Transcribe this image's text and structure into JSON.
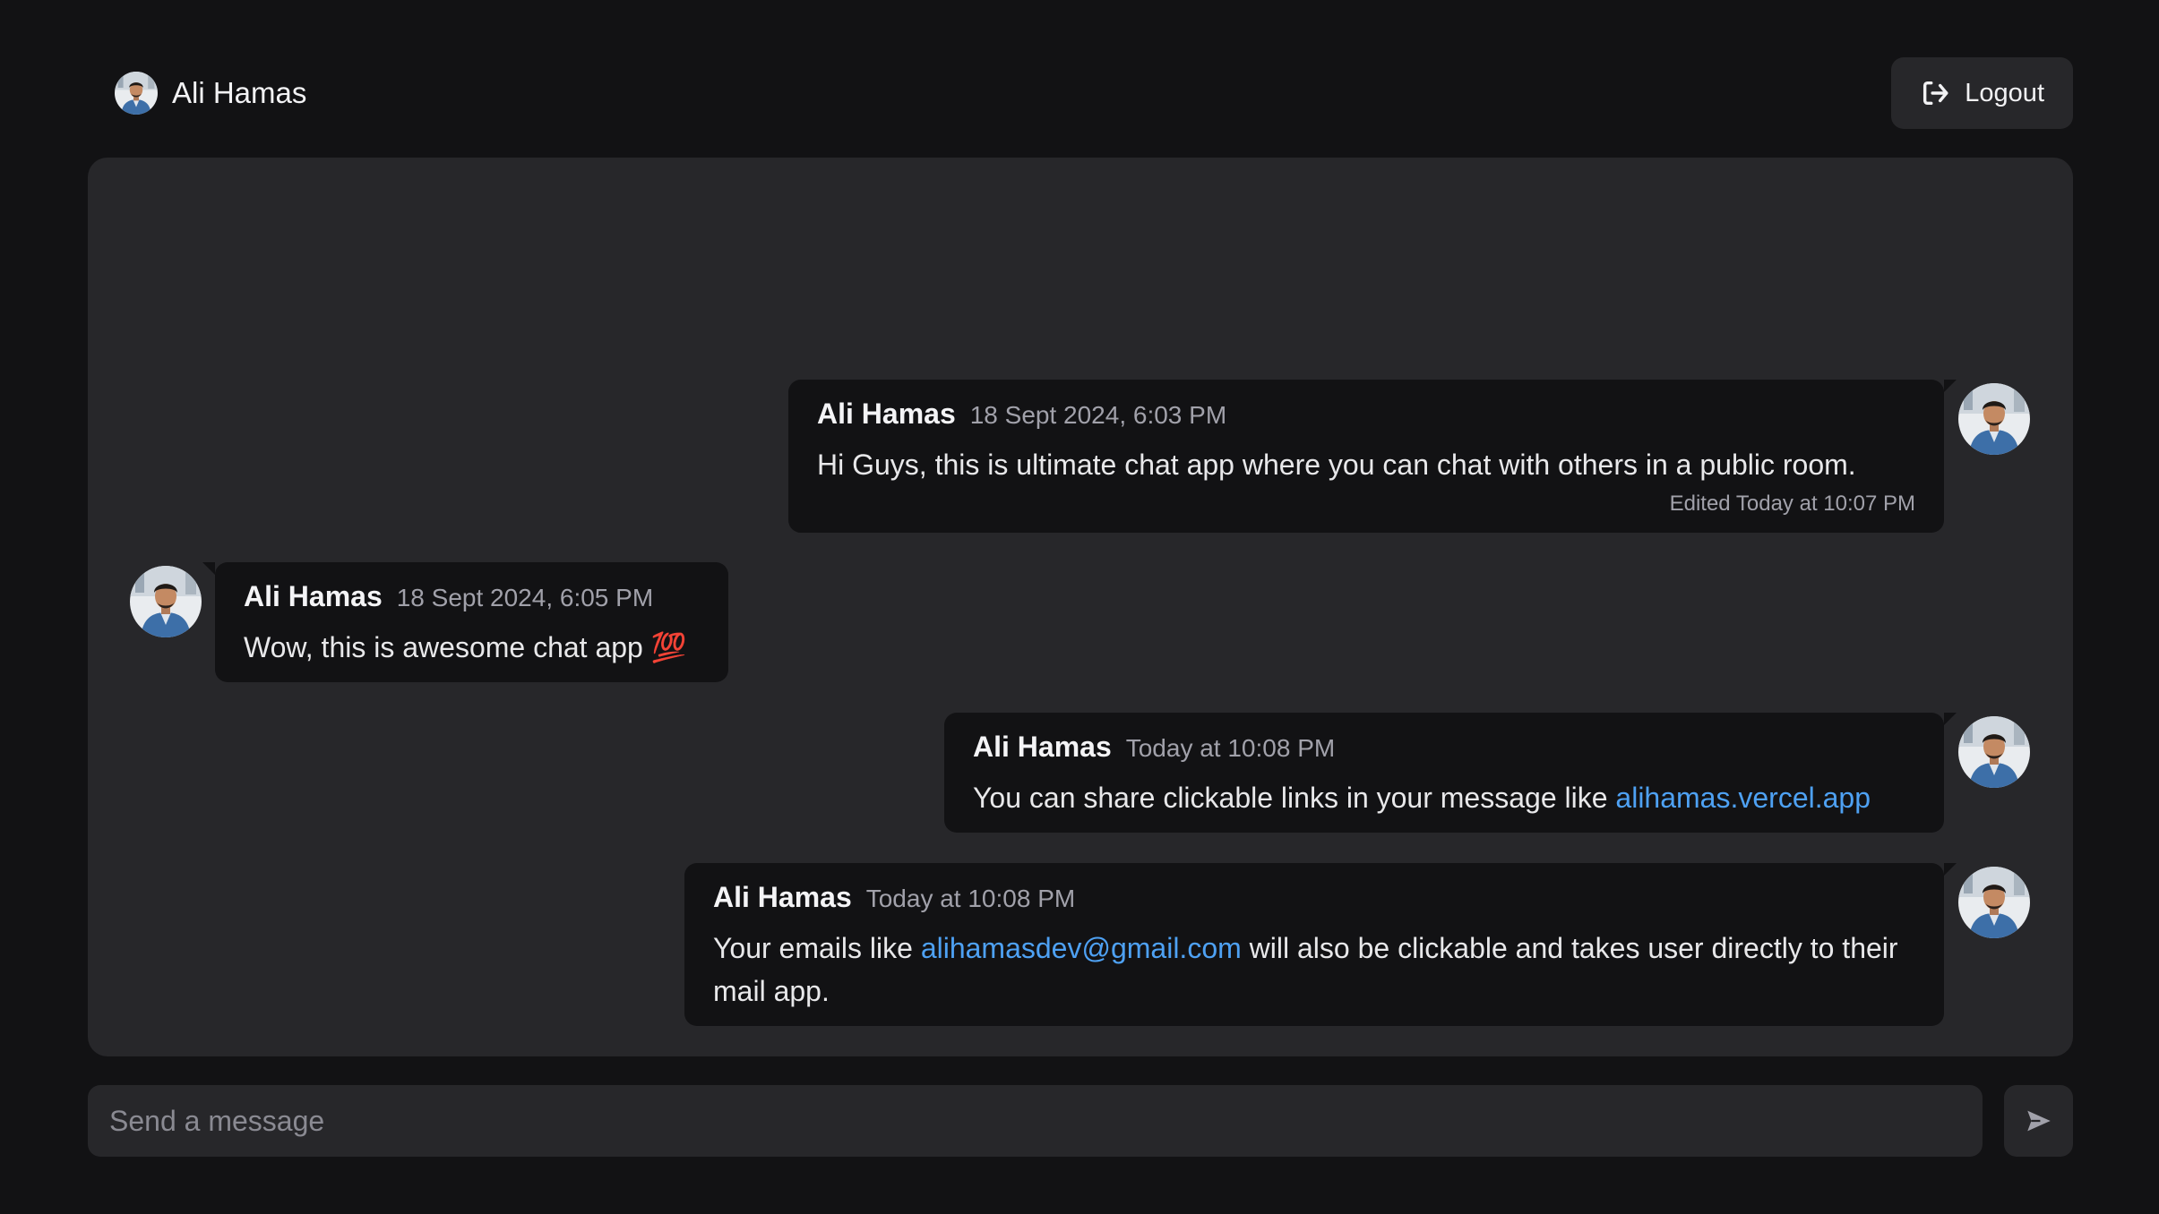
{
  "header": {
    "user_name": "Ali Hamas",
    "logout_label": "Logout"
  },
  "messages": [
    {
      "author": "Ali Hamas",
      "time": "18 Sept 2024, 6:03 PM",
      "text": "Hi Guys, this is ultimate chat app where you can chat with others in a public room.",
      "edited": "Edited Today at 10:07 PM",
      "side": "right"
    },
    {
      "author": "Ali Hamas",
      "time": "18 Sept 2024, 6:05 PM",
      "text": "Wow, this is awesome chat app",
      "emoji": "💯",
      "side": "left"
    },
    {
      "author": "Ali Hamas",
      "time": "Today at 10:08 PM",
      "text": "You can share clickable links in your message like",
      "link": "alihamas.vercel.app",
      "side": "right"
    },
    {
      "author": "Ali Hamas",
      "time": "Today at 10:08 PM",
      "text_before": "Your emails like",
      "link": "alihamasdev@gmail.com",
      "text_after": "will also be clickable and takes user directly to their mail app.",
      "side": "right"
    }
  ],
  "composer": {
    "placeholder": "Send a message",
    "value": ""
  },
  "icons": {
    "logout": "logout-icon",
    "send": "send-icon",
    "avatar": "user-avatar"
  },
  "colors": {
    "background": "#121214",
    "panel": "#27272a",
    "bubble": "#121214",
    "link": "#4ea1f3",
    "muted": "#a1a1aa"
  }
}
